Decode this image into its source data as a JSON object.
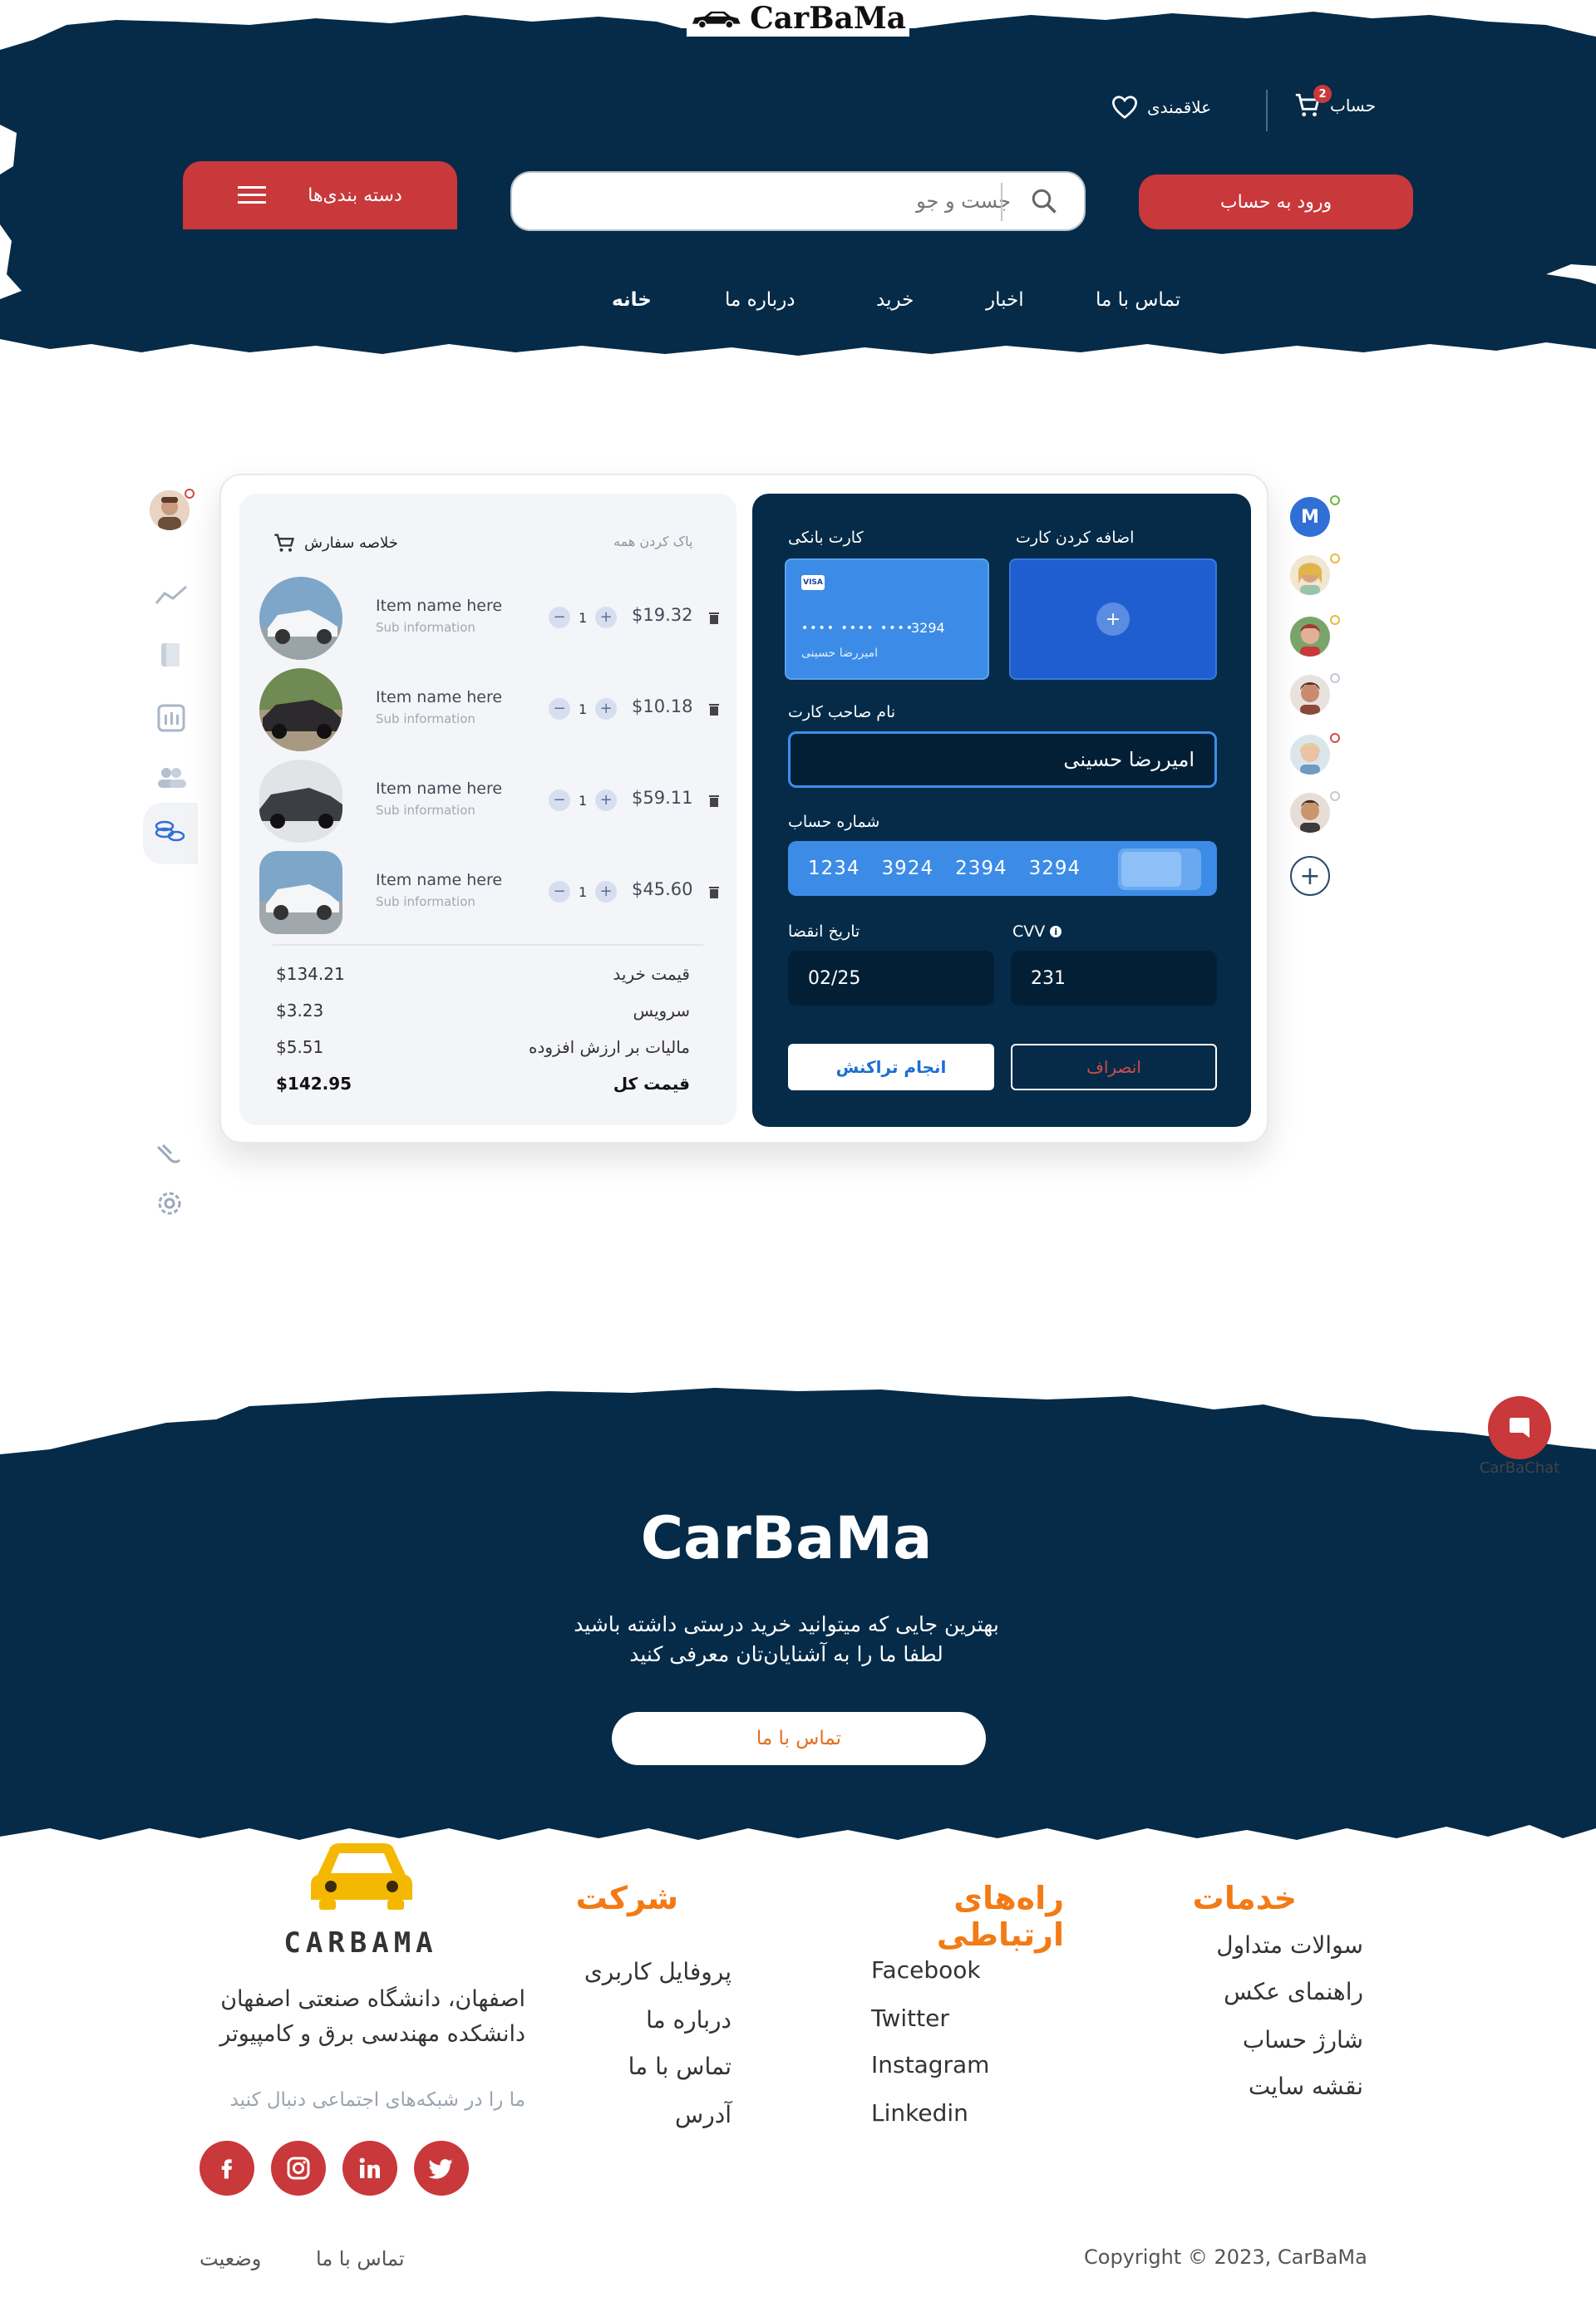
{
  "header": {
    "logo_text": "CarBaMa",
    "account_label": "حساب",
    "cart_count": "2",
    "favorites_label": "علاقمندی",
    "login_label": "ورود به حساب",
    "search_placeholder": "جست و جو",
    "categories_label": "دسته بندی‌ها",
    "nav": [
      "خانه",
      "درباره ما",
      "خرید",
      "اخبار",
      "تماس با ما"
    ]
  },
  "summary": {
    "title": "خلاصه سفارش",
    "clear_all": "پاک کردن همه",
    "items": [
      {
        "name": "Item name here",
        "sub": "Sub information",
        "qty": "1",
        "price": "$19.32"
      },
      {
        "name": "Item name here",
        "sub": "Sub information",
        "qty": "1",
        "price": "$10.18"
      },
      {
        "name": "Item name here",
        "sub": "Sub information",
        "qty": "1",
        "price": "$59.11"
      },
      {
        "name": "Item name here",
        "sub": "Sub information",
        "qty": "1",
        "price": "$45.60"
      }
    ],
    "totals": [
      {
        "label": "قیمت خرید",
        "value": "$134.21"
      },
      {
        "label": "سرویس",
        "value": "$3.23"
      },
      {
        "label": "مالیات بر ارزش افزوده",
        "value": "$5.51"
      },
      {
        "label": "قیمت کل",
        "value": "$142.95"
      }
    ]
  },
  "payment": {
    "bank_card_label": "کارت بانکی",
    "add_card_label": "اضافه کردن کارت",
    "card_brand": "VISA",
    "card_masked": "•••• •••• ••••",
    "card_last4": "3294",
    "card_holder_small": "امیررضا حسینی",
    "holder_label": "نام صاحب کارت",
    "holder_value": "امیررضا حسینی",
    "account_label": "شماره حساب",
    "account_groups": [
      "1234",
      "3924",
      "2394",
      "3294"
    ],
    "expiry_label": "تاریخ انقضا",
    "expiry_value": "02/25",
    "cvv_label": "CVV",
    "cvv_value": "231",
    "confirm_label": "انجام تراکنش",
    "cancel_label": "انصراف"
  },
  "contacts": {
    "first_initial": "M"
  },
  "footer": {
    "brand": "CarBaMa",
    "tagline_1": "بهترین جایی که میتوانید خرید درستی داشته باشید",
    "tagline_2": "لطفا ما را به آشنایان‌تان معرفی کنید",
    "contact_btn": "تماس با ما",
    "chat_label": "CarBaChat",
    "logo_word": "CARBAMA",
    "address_1": "اصفهان، دانشگاه صنعتی اصفهان",
    "address_2": "دانشکده مهندسی برق و کامپیوتر",
    "follow_text": "ما را در شبکه‌های اجتماعی دنبال کنید",
    "services": {
      "title": "خدمات",
      "links": [
        "سوالات متداول",
        "راهنمای عکس",
        "شارژ حساب",
        "نقشه سایت"
      ]
    },
    "channels": {
      "title": "راه‌های ارتباطی",
      "links": [
        "Facebook",
        "Twitter",
        "Instagram",
        "Linkedin"
      ]
    },
    "company": {
      "title": "شرکت",
      "links": [
        "پروفایل کاربری",
        "درباره ما",
        "تماس با ما",
        "آدرس"
      ]
    },
    "copyright": "Copyright © 2023, CarBaMa",
    "bottom_links": [
      "وضعیت",
      "تماس با ما"
    ]
  },
  "colors": {
    "navy": "#052b48",
    "accent_red": "#c9383a",
    "accent_orange": "#f37a14",
    "card_blue": "#3c8ce7"
  }
}
